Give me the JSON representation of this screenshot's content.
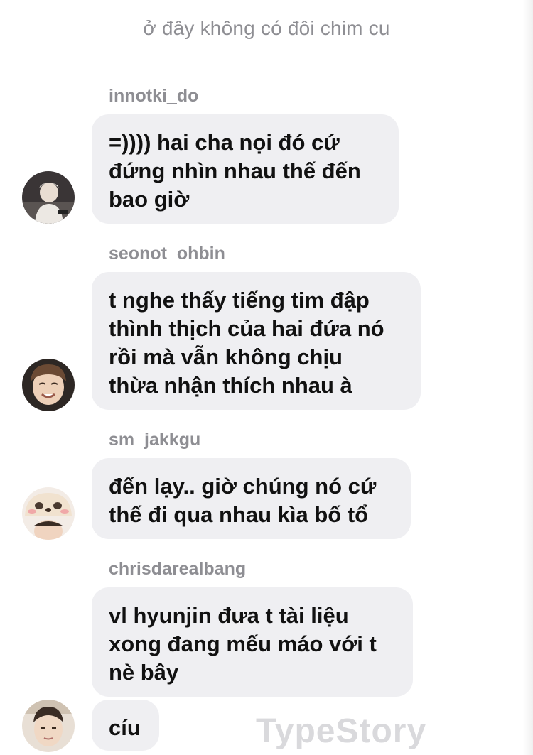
{
  "chat": {
    "title": "ở đây không có đôi chim cu"
  },
  "messages": [
    {
      "username": "innotki_do",
      "text": "=)))) hai cha nọi đó cứ\nđứng nhìn nhau thế đến\nbao giờ",
      "avatar": "avatar-innotki_do"
    },
    {
      "username": "seonot_ohbin",
      "text": "t nghe thấy tiếng tim đập\nthình thịch của hai đứa nó\nrồi mà vẫn không chịu\nthừa nhận thích nhau à",
      "avatar": "avatar-seonot_ohbin"
    },
    {
      "username": "sm_jakkgu",
      "text": "đến lạy.. giờ chúng nó cứ\nthế đi qua nhau kìa bố tổ",
      "avatar": "avatar-sm_jakkgu"
    },
    {
      "username": "chrisdarealbang",
      "text": "vl hyunjin đưa t tài liệu\nxong đang mếu máo với t\nnè bây",
      "extra_text": "cíu",
      "avatar": "avatar-chrisdarealbang"
    }
  ],
  "watermark": "TypeStory"
}
